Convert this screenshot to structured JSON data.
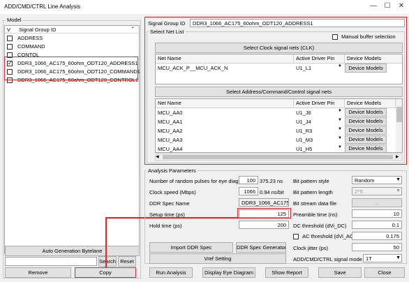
{
  "window": {
    "title": "ADD/CMD/CTRL Line Analysis",
    "minimize": "—",
    "maximize": "☐",
    "close": "✕"
  },
  "model": {
    "label": "Model",
    "col_v": "V",
    "col_id": "Signal Group ID",
    "items": [
      {
        "label": "ADDRESS",
        "checked": false
      },
      {
        "label": "COMMAND",
        "checked": false
      },
      {
        "label": "CONTOL",
        "checked": false
      },
      {
        "label": "DDR3_1066_AC175_60ohm_ODT120_ADDRESS1",
        "checked": true
      },
      {
        "label": "DDR3_1066_AC175_60ohm_ODT120_COMMAND1",
        "checked": false
      },
      {
        "label": "DDR3_1066_AC175_60ohm_ODT120_CONTROL1",
        "checked": false
      }
    ],
    "auto_gen": "Auto Generation Bytelane",
    "search_value": "",
    "search": "Search",
    "reset": "Reset",
    "remove": "Remove",
    "copy": "Copy"
  },
  "signal_group": {
    "label": "Signal Group ID",
    "value": "DDR3_1066_AC175_60ohm_ODT120_ADDRESS1"
  },
  "net_list": {
    "label": "Select Net List",
    "manual_buffer": "Manual buffer selection",
    "clk_button": "Select Clock signal nets (CLK)",
    "clk_headers": [
      "Net Name",
      "Active Driver Pin",
      "Device Models"
    ],
    "clk_rows": [
      {
        "net": "MCU_ACK_P__MCU_ACK_N",
        "pin": "U1_L1",
        "model": "Device Models"
      }
    ],
    "addr_button": "Select Address/Command/Control signal nets",
    "addr_headers": [
      "Net Name",
      "Active Driver Pin",
      "Device Models"
    ],
    "addr_rows": [
      {
        "net": "MCU_AA0",
        "pin": "U1_J6",
        "model": "Device Models"
      },
      {
        "net": "MCU_AA1",
        "pin": "U1_J4",
        "model": "Device Models"
      },
      {
        "net": "MCU_AA2",
        "pin": "U1_R3",
        "model": "Device Models"
      },
      {
        "net": "MCU_AA3",
        "pin": "U1_M3",
        "model": "Device Models"
      },
      {
        "net": "MCU_AA4",
        "pin": "U1_H5",
        "model": "Device Models"
      }
    ]
  },
  "analysis": {
    "label": "Analysis Parameters",
    "random_pulses_label": "Number of random pulses for eye diagram",
    "random_pulses": "100",
    "random_pulses_ns": "375.23 ns",
    "clock_speed_label": "Clock speed (Mbps)",
    "clock_speed": "1066",
    "clock_speed_unit": "0.94 ns/bit",
    "ddr_spec_label": "DDR Spec Name",
    "ddr_spec": "DDR3_1066_AC175",
    "setup_label": "Setup time (ps)",
    "setup": "125",
    "hold_label": "Hold time (ps)",
    "hold": "200",
    "import_spec": "Import DDR Spec",
    "spec_generator": "DDR Spec Generator",
    "vref": "Vref Setting",
    "bit_pattern_style_label": "Bit pattern style",
    "bit_pattern_style": "Random",
    "bit_pattern_length_label": "Bit pattern length",
    "bit_pattern_length": "2^5",
    "bit_stream_label": "Bit stream data file",
    "bit_stream_button": "...",
    "preamble_label": "Preamble time (ns)",
    "preamble": "10",
    "dc_threshold_label": "DC threshold (dVi_DC)",
    "dc_threshold": "0.1",
    "ac_threshold_label": "AC threshold (dVi_AC)",
    "ac_threshold": "0.175",
    "clock_jitter_label": "Clock jitter (ps)",
    "clock_jitter": "50",
    "signal_mode_label": "ADD/CMD/CTRL signal mode",
    "signal_mode": "1T"
  },
  "footer": {
    "run": "Run Analysis",
    "eye": "Display Eye Diagram",
    "report": "Show Report",
    "save": "Save",
    "close": "Close"
  }
}
